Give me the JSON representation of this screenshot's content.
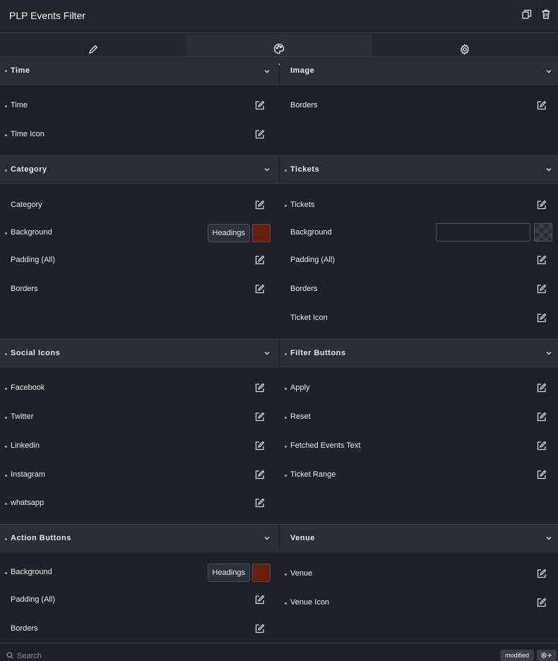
{
  "header": {
    "title": "PLP Events Filter",
    "duplicate_icon": "duplicate-icon",
    "delete_icon": "trash-icon"
  },
  "tabs": [
    {
      "icon": "pencil-icon",
      "active": false
    },
    {
      "icon": "palette-icon",
      "active": true
    },
    {
      "icon": "gear-icon",
      "active": false
    }
  ],
  "left": {
    "time": {
      "title": "Time",
      "items": [
        "Time",
        "Time Icon"
      ]
    },
    "category": {
      "title": "Category",
      "items": [
        "Category",
        "Background",
        "Padding (All)",
        "Borders"
      ],
      "headings_label": "Headings",
      "swatch": "#6a1f0c"
    },
    "social": {
      "title": "Social Icons",
      "items": [
        "Facebook",
        "Twitter",
        "Linkedin",
        "Instagram",
        "whatsapp"
      ]
    },
    "action": {
      "title": "Action Buttons",
      "items": [
        "Background",
        "Padding (All)",
        "Borders"
      ],
      "headings_label": "Headings",
      "swatch": "#6a1f0c"
    }
  },
  "right": {
    "image": {
      "title": "Image",
      "items": [
        "Borders"
      ]
    },
    "tickets": {
      "title": "Tickets",
      "items": [
        "Tickets",
        "Background",
        "Padding (All)",
        "Borders",
        "Ticket Icon"
      ]
    },
    "filter": {
      "title": "Filter Buttons",
      "items": [
        "Apply",
        "Reset",
        "Fetched Events Text",
        "Ticket Range"
      ]
    },
    "venue": {
      "title": "Venue",
      "items": [
        "Venue",
        "Venue Icon"
      ]
    }
  },
  "footer": {
    "search_placeholder": "Search",
    "badge": "modified"
  },
  "colors": {
    "bg": "#1f2128",
    "section": "#2a2d36",
    "accent_swatch": "#6a1f0c"
  }
}
